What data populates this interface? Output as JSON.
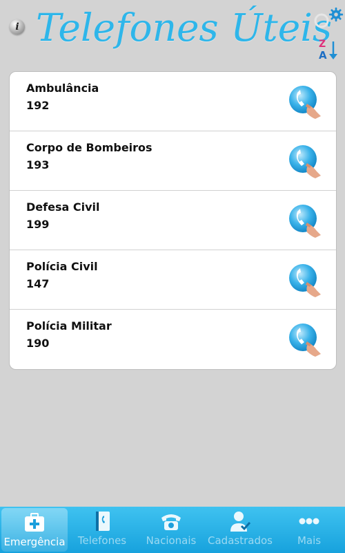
{
  "header": {
    "title": "Telefones Úteis",
    "info_icon": "info-icon",
    "settings_icon": "gear-icon",
    "sort_icon": "sort-z-a-icon",
    "sort_letter_top": "Z",
    "sort_letter_bottom": "A",
    "info_glyph": "i"
  },
  "contacts": [
    {
      "name": "Ambulância",
      "number": "192"
    },
    {
      "name": "Corpo de Bombeiros",
      "number": "193"
    },
    {
      "name": "Defesa Civil",
      "number": "199"
    },
    {
      "name": "Polícia Civil",
      "number": "147"
    },
    {
      "name": "Polícia Militar",
      "number": "190"
    }
  ],
  "tabs": [
    {
      "label": "Emergência",
      "icon": "first-aid-kit-icon",
      "active": true
    },
    {
      "label": "Telefones",
      "icon": "phone-book-icon",
      "active": false
    },
    {
      "label": "Nacionais",
      "icon": "telephone-icon",
      "active": false
    },
    {
      "label": "Cadastrados",
      "icon": "user-check-icon",
      "active": false
    },
    {
      "label": "Mais",
      "icon": "more-dots-icon",
      "active": false
    }
  ],
  "colors": {
    "title": "#2eb6ea",
    "tabbar": "#17a2dd",
    "background": "#d3d3d3"
  }
}
